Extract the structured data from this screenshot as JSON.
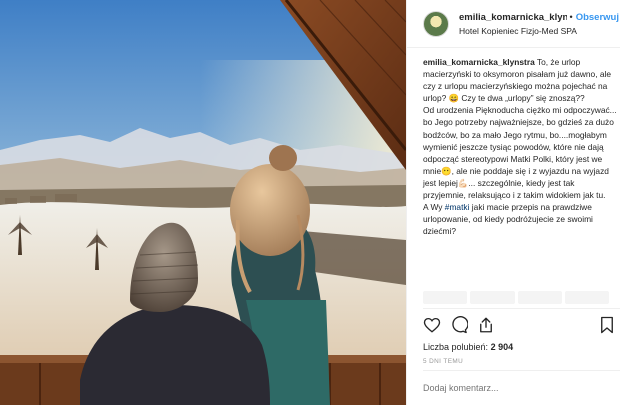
{
  "post": {
    "username": "emilia_komarnicka_klynstr",
    "separator": "•",
    "follow_label": "Obserwuj",
    "location": "Hotel Kopieniec Fizjo-Med SPA"
  },
  "caption": {
    "username": "emilia_komarnicka_klynstra",
    "paragraph1": "To, że urlop macierzyński to oksymoron pisałam już dawno, ale czy z urlopu macierzyńskiego można pojechać na urlop? 😄 Czy te dwa „urlopy” się znoszą??",
    "paragraph2": "Od urodzenia Pięknoducha ciężko mi odpoczywać... bo Jego potrzeby najważniejsze, bo gdzieś za dużo bodźców, bo za mało Jego rytmu, bo....mogłabym wymienić jeszcze tysiąc powodów, które nie dają odpocząć stereotypowi Matki Polki, który jest we mnie😶, ale nie poddaje się i z wyjazdu na wyjazd jest lepiej💪🏻... szczególnie, kiedy jest tak przyjemnie, relaksująco i z takim widokiem jak tu.",
    "paragraph3_prefix": "A Wy ",
    "hashtag": "#matki",
    "paragraph3_suffix": " jaki macie przepis na prawdziwe urlopowanie, od kiedy podróżujecie ze swoimi dziećmi?"
  },
  "stats": {
    "likes_label": "Liczba polubień:",
    "likes_count": "2 904",
    "time_ago": "5 DNI TEMU"
  },
  "comment": {
    "placeholder": "Dodaj komentarz..."
  },
  "icons": {
    "like": "heart-icon",
    "comment": "comment-bubble-icon",
    "share": "share-icon",
    "save": "bookmark-icon"
  }
}
